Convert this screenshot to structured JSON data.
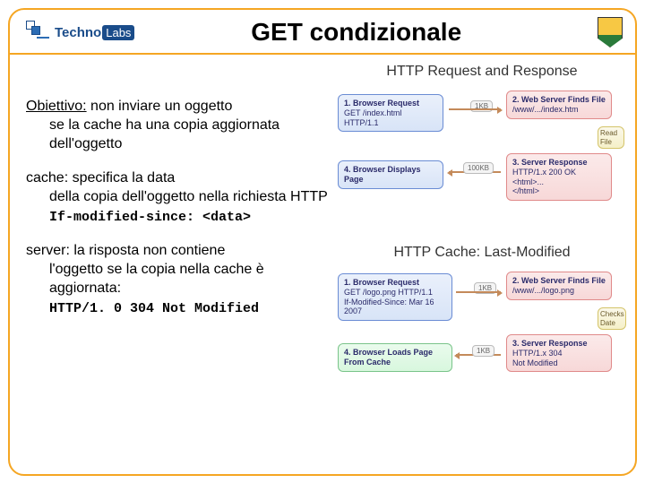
{
  "header": {
    "logo_text": "Techno",
    "logo_suffix": "Labs",
    "title": "GET condizionale"
  },
  "body": {
    "obiettivo_lead": "Obiettivo:",
    "obiettivo_text": " non inviare un oggetto",
    "obiettivo_indent": "se la cache ha una copia aggiornata dell'oggetto",
    "cache_lead": "cache:",
    "cache_text": " specifica la data",
    "cache_indent": "della copia dell'oggetto nella richiesta HTTP",
    "cache_code": "If-modified-since: <data>",
    "server_lead": "server:",
    "server_text": " la risposta non contiene",
    "server_indent": "l'oggetto se la copia nella cache è aggiornata:",
    "server_code": "HTTP/1. 0 304 Not Modified"
  },
  "diagram1": {
    "title": "HTTP Request and Response",
    "b1_title": "1. Browser Request",
    "b1_sub": "GET /index.html HTTP/1.1",
    "b1_size": "1KB",
    "b2_title": "2. Web Server Finds File",
    "b2_sub": "/www/.../index.htm",
    "b3_title": "3. Server Response",
    "b3_sub": "HTTP/1.x 200 OK\n<html>...\n</html>",
    "b3_size": "100KB",
    "b3_side": "Read File",
    "b4_title": "4. Browser Displays Page"
  },
  "diagram2": {
    "title": "HTTP Cache: Last-Modified",
    "b1_title": "1. Browser Request",
    "b1_sub": "GET /logo.png HTTP/1.1\nIf-Modified-Since: Mar 16 2007",
    "b1_size": "1KB",
    "b2_title": "2. Web Server Finds File",
    "b2_sub": "/www/.../logo.png",
    "b3_title": "3. Server Response",
    "b3_sub": "HTTP/1.x 304\nNot Modified",
    "b3_size": "1KB",
    "b3_side": "Checks Date",
    "b4_title": "4. Browser Loads Page From Cache"
  }
}
